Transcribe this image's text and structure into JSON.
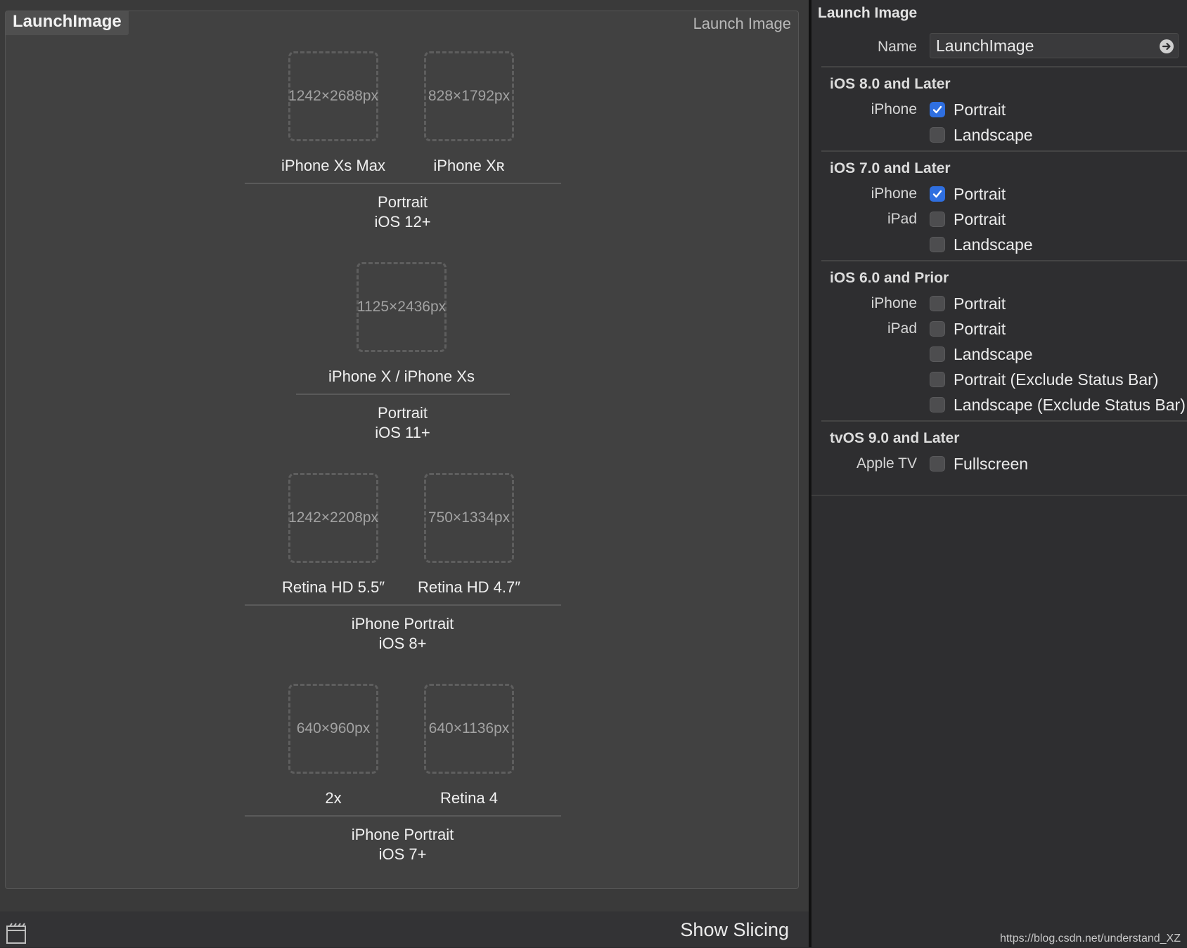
{
  "asset": {
    "name": "LaunchImage",
    "type_label": "Launch Image"
  },
  "groups": [
    {
      "slots": [
        {
          "size": "1242×2688px",
          "label": "iPhone Xs Max"
        },
        {
          "size": "828×1792px",
          "label": "iPhone Xʀ"
        }
      ],
      "caption": [
        "Portrait",
        "iOS 12+"
      ]
    },
    {
      "slots": [
        {
          "size": "1125×2436px",
          "label": "iPhone X / iPhone Xs"
        }
      ],
      "caption": [
        "Portrait",
        "iOS 11+"
      ]
    },
    {
      "slots": [
        {
          "size": "1242×2208px",
          "label": "Retina HD 5.5″"
        },
        {
          "size": "750×1334px",
          "label": "Retina HD 4.7″"
        }
      ],
      "caption": [
        "iPhone Portrait",
        "iOS 8+"
      ]
    },
    {
      "slots": [
        {
          "size": "640×960px",
          "label": "2x"
        },
        {
          "size": "640×1136px",
          "label": "Retina 4"
        }
      ],
      "caption": [
        "iPhone Portrait",
        "iOS 7+"
      ]
    }
  ],
  "bottom_bar": {
    "slicing_icon": "slicing-toggle-icon",
    "show_slicing": "Show Slicing"
  },
  "inspector": {
    "title": "Launch Image",
    "name_label": "Name",
    "name_value": "LaunchImage",
    "sections": [
      {
        "title": "iOS 8.0 and Later",
        "rows": [
          {
            "device": "iPhone",
            "option": "Portrait",
            "checked": true
          },
          {
            "device": "",
            "option": "Landscape",
            "checked": false
          }
        ]
      },
      {
        "title": "iOS 7.0 and Later",
        "rows": [
          {
            "device": "iPhone",
            "option": "Portrait",
            "checked": true
          },
          {
            "device": "iPad",
            "option": "Portrait",
            "checked": false
          },
          {
            "device": "",
            "option": "Landscape",
            "checked": false
          }
        ]
      },
      {
        "title": "iOS 6.0 and Prior",
        "rows": [
          {
            "device": "iPhone",
            "option": "Portrait",
            "checked": false
          },
          {
            "device": "iPad",
            "option": "Portrait",
            "checked": false
          },
          {
            "device": "",
            "option": "Landscape",
            "checked": false
          },
          {
            "device": "",
            "option": "Portrait (Exclude Status Bar)",
            "checked": false
          },
          {
            "device": "",
            "option": "Landscape (Exclude Status Bar)",
            "checked": false
          }
        ]
      },
      {
        "title": "tvOS 9.0 and Later",
        "rows": [
          {
            "device": "Apple TV",
            "option": "Fullscreen",
            "checked": false
          }
        ]
      }
    ],
    "accent_color": "#2f6fe0"
  },
  "watermark": "https://blog.csdn.net/understand_XZ"
}
